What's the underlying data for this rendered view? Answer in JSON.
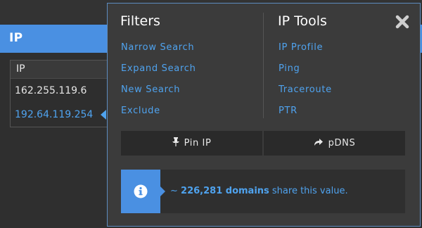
{
  "ip_panel": {
    "header_title": "IP",
    "table_header": "IP",
    "rows": [
      "162.255.119.6",
      "192.64.119.254"
    ],
    "selected_index": 1
  },
  "popover": {
    "filters": {
      "title": "Filters",
      "items": [
        "Narrow Search",
        "Expand Search",
        "New Search",
        "Exclude"
      ]
    },
    "ip_tools": {
      "title": "IP Tools",
      "items": [
        "IP Profile",
        "Ping",
        "Traceroute",
        "PTR"
      ]
    },
    "buttons": {
      "pin_label": "Pin IP",
      "pin_icon": "pin-icon",
      "pdns_label": "pDNS",
      "pdns_icon": "share-arrow-icon"
    },
    "info": {
      "icon": "info-icon",
      "prefix": "~ ",
      "count_text": "226,281 domains",
      "suffix": " share this value."
    },
    "close_icon": "close-icon"
  },
  "colors": {
    "accent": "#4a90e2",
    "link": "#4fa3ef",
    "popover_bg": "#3b3b3b"
  }
}
